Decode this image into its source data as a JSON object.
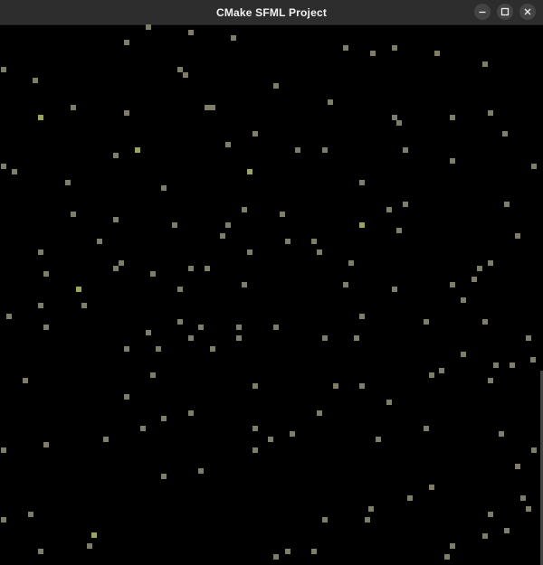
{
  "window": {
    "title": "CMake SFML Project",
    "controls": [
      {
        "name": "minimize-button",
        "icon": "minimize-icon"
      },
      {
        "name": "maximize-button",
        "icon": "maximize-icon"
      },
      {
        "name": "close-button",
        "icon": "close-icon"
      }
    ]
  },
  "colors": {
    "background": "#000000",
    "titlebar": "#2d2d2d",
    "particle_gray": "#7d7d6a",
    "particle_green": "#9ca45a"
  }
}
